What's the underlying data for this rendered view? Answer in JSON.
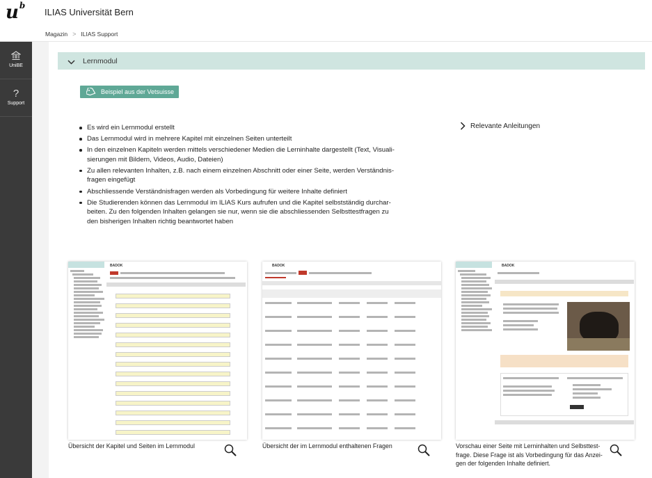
{
  "header": {
    "logo_main": "u",
    "logo_sup": "b",
    "title": "ILIAS Universität Bern"
  },
  "breadcrumb": {
    "items": [
      "Magazin",
      "ILIAS Support"
    ],
    "separator": ">"
  },
  "sidebar": {
    "items": [
      {
        "label": "UniBE",
        "icon": "bank-icon"
      },
      {
        "label": "Support",
        "icon": "question-icon"
      }
    ]
  },
  "accordion": {
    "title": "Lernmodul",
    "expanded": true
  },
  "example_button": {
    "label": "Beispiel aus der Vetsuisse",
    "icon": "tag-icon",
    "color": "#5fa896"
  },
  "bullets": [
    "Es wird ein Lernmodul erstellt",
    "Das Lernmodul wird in mehrere Kapitel mit einzelnen Seiten unterteilt",
    "In den einzelnen Kapiteln werden mittels verschiedener Medien die Lerninhalte dargestellt (Text, Visuali-\nsierungen mit Bildern, Videos, Audio, Dateien)",
    "Zu allen relevanten Inhalten, z.B. nach einem einzelnen Abschnitt oder einer Seite, werden Verständnis-\nfragen eingefügt",
    "Abschliessende Verständnisfragen werden als Vorbedingung für weitere Inhalte definiert",
    "Die Studierenden können das Lernmodul im ILIAS Kurs aufrufen und die Kapitel selbstständig durchar-\nbeiten. Zu den folgenden Inhalten gelangen sie nur, wenn sie die abschliessenden Selbsttestfragen zu\nden bisherigen Inhalten richtig beantwortet haben"
  ],
  "related": {
    "label": "Relevante Anleitungen"
  },
  "screenshots": [
    {
      "caption": "Übersicht der Kapitel und Seiten im Lernmodul",
      "app_title": "BADOK",
      "zoom_icon": "magnifier-icon"
    },
    {
      "caption": "Übersicht der im Lernmodul enthaltenen Fragen",
      "app_title": "BADOK",
      "zoom_icon": "magnifier-icon"
    },
    {
      "caption": "Vorschau einer Seite mit Lerninhalten und Selbsttest-\nfrage. Diese Frage ist als Vorbedingung für das Anzei-\ngen der folgenden Inhalte definiert.",
      "app_title": "BADOK",
      "zoom_icon": "magnifier-icon"
    }
  ],
  "colors": {
    "sidebar_bg": "#3a3a3a",
    "accordion_bg": "#cfe5e0",
    "content_bg": "#f3f3f3",
    "ilias_red": "#c0392b"
  }
}
